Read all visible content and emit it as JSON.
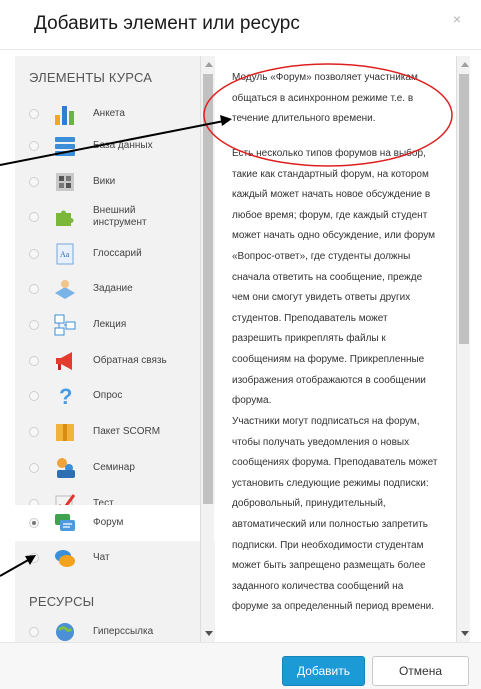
{
  "dialog": {
    "title": "Добавить элемент или ресурс",
    "close_symbol": "×"
  },
  "sections": {
    "activities": "ЭЛЕМЕНТЫ КУРСА",
    "resources": "РЕСУРСЫ"
  },
  "activities": [
    {
      "label": "Анкета",
      "icon": "survey-chart-icon",
      "selected": false
    },
    {
      "label": "База данных",
      "icon": "database-icon",
      "selected": false
    },
    {
      "label": "Вики",
      "icon": "wiki-icon",
      "selected": false
    },
    {
      "label": "Внешний инструмент",
      "icon": "puzzle-icon",
      "selected": false
    },
    {
      "label": "Глоссарий",
      "icon": "glossary-icon",
      "selected": false
    },
    {
      "label": "Задание",
      "icon": "assignment-icon",
      "selected": false
    },
    {
      "label": "Лекция",
      "icon": "lesson-icon",
      "selected": false
    },
    {
      "label": "Обратная связь",
      "icon": "megaphone-icon",
      "selected": false
    },
    {
      "label": "Опрос",
      "icon": "question-icon",
      "selected": false
    },
    {
      "label": "Пакет SCORM",
      "icon": "package-icon",
      "selected": false
    },
    {
      "label": "Семинар",
      "icon": "workshop-icon",
      "selected": false
    },
    {
      "label": "Тест",
      "icon": "quiz-icon",
      "selected": false
    },
    {
      "label": "Форум",
      "icon": "forum-icon",
      "selected": true
    },
    {
      "label": "Чат",
      "icon": "chat-icon",
      "selected": false
    }
  ],
  "resources": [
    {
      "label": "Гиперссылка",
      "icon": "url-icon",
      "selected": false
    }
  ],
  "description": {
    "p1": "Модуль «Форум» позволяет участникам общаться в асинхронном режиме т.е. в течение длительного времени.",
    "p2": "Есть несколько типов форумов на выбор, такие как стандартный форум, на котором каждый может начать новое обсуждение в любое время; форум, где каждый студент может начать одно обсуждение, или форум «Вопрос-ответ», где студенты должны сначала ответить на сообщение, прежде чем они смогут увидеть ответы других студентов. Преподаватель может разрешить прикреплять файлы к сообщениям на форуме. Прикрепленные изображения отображаются в сообщении форума.",
    "p3": "Участники могут подписаться на форум, чтобы получать уведомления о новых сообщениях форума. Преподаватель может установить следующие режимы подписки: добровольный, принудительный, автоматический или полностью запретить подписки. При необходимости студентам может быть запрещено размещать более заданного количества сообщений на форуме за определенный период времени."
  },
  "footer": {
    "add_label": "Добавить",
    "cancel_label": "Отмена"
  },
  "colors": {
    "primary": "#1c9ad6",
    "annotation": "#e02020"
  }
}
